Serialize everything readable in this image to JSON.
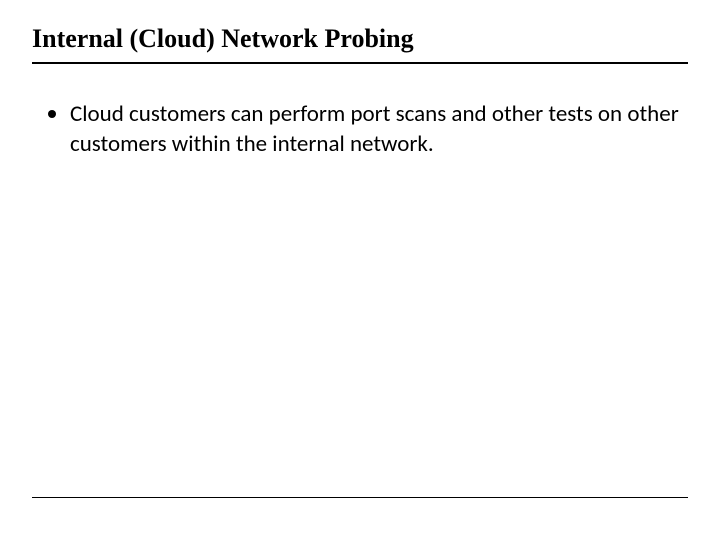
{
  "slide": {
    "title": "Internal (Cloud) Network Probing",
    "bullets": [
      {
        "text": "Cloud customers can perform port scans and other tests on other customers within the internal network."
      }
    ]
  }
}
